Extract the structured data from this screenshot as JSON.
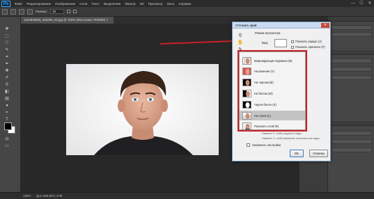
{
  "menubar": {
    "logo": "Ps",
    "items": [
      "Файл",
      "Редактирование",
      "Изображение",
      "Слои",
      "Текст",
      "Выделение",
      "Фильтр",
      "3D",
      "Просмотр",
      "Окно",
      "Справка"
    ],
    "min": "—",
    "max": "☐",
    "close": "✕"
  },
  "optbar": {
    "size_label": "Размер:",
    "size_value": "30"
  },
  "document": {
    "tab_label": "1322839300_466305_03.jpg @ 100% (Фон копия, RGB/8#) ×"
  },
  "dialog": {
    "title": "Уточнить край",
    "close": "✕",
    "section_title": "Режим просмотра",
    "view_label": "Вид:",
    "show_radius": "Показать радиус (J)",
    "show_original": "Показать оригинал (P)",
    "hint1": "Нажмите F, чтобы выделить виды.",
    "hint2": "Нажмите X, чтобы временно отключить все виды.",
    "remember": "Запомнить настройки",
    "ok": "OK",
    "cancel": "Отмена",
    "views": [
      {
        "label": "Марширующие муравьи (M)",
        "thumb": "ants"
      },
      {
        "label": "Наложение (V)",
        "thumb": "overlay"
      },
      {
        "label": "На черном (B)",
        "thumb": "black"
      },
      {
        "label": "На белом (W)",
        "thumb": "white"
      },
      {
        "label": "Черно-белое (K)",
        "thumb": "bw"
      },
      {
        "label": "На слоях (L)",
        "thumb": "layers"
      },
      {
        "label": "Показать слой (R)",
        "thumb": "reveal"
      }
    ],
    "selected_view": "На слоях (L)"
  },
  "statusbar": {
    "zoom": "100%",
    "doc": "Док: 585,9K/1,17M"
  },
  "colors": {
    "highlight": "#c8202a",
    "dialog_title_bg": "#c9daf0"
  }
}
